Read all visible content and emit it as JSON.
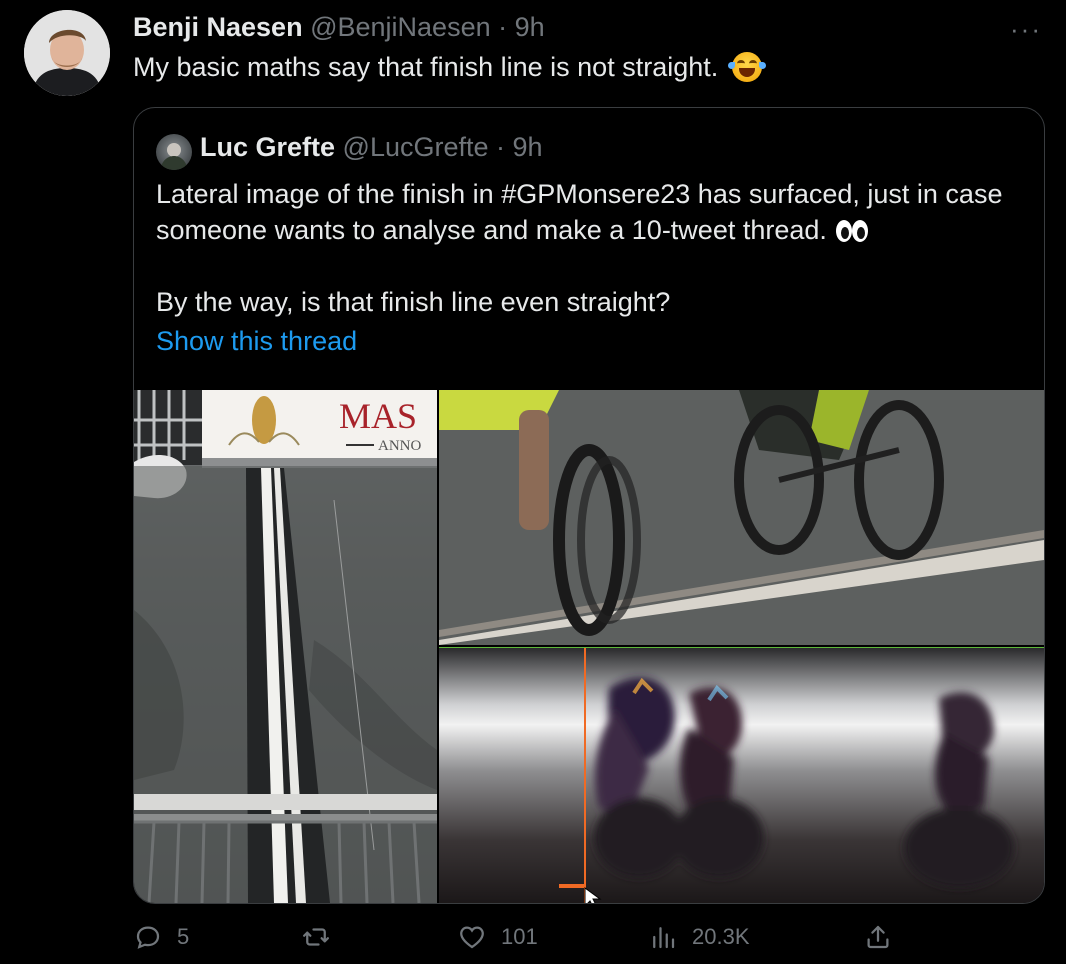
{
  "tweet": {
    "author_name": "Benji Naesen",
    "author_handle": "@BenjiNaesen",
    "time": "· 9h",
    "text": "My basic maths say that finish line is not straight.",
    "more_label": "···"
  },
  "quoted_tweet": {
    "author_name": "Luc Grefte",
    "author_handle": "@LucGrefte",
    "time": "· 9h",
    "paragraph_1": "Lateral image of the finish in #GPMonsere23 has surfaced, just in case someone wants to analyse and make a 10-tweet thread.",
    "paragraph_2": "By the way, is that finish line even straight?",
    "show_thread_label": "Show this thread",
    "media": {
      "banner_text": "MAS",
      "banner_subtext": "ANNO"
    }
  },
  "actions": {
    "replies": "5",
    "retweets": "",
    "likes": "101",
    "views": "20.3K"
  },
  "colors": {
    "background": "#000000",
    "text": "#e7e9ea",
    "muted": "#71767b",
    "link": "#1d9bf0",
    "border": "#3a3d40"
  }
}
